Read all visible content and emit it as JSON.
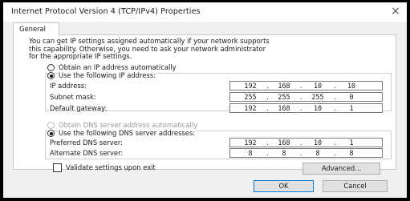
{
  "window": {
    "title": "Internet Protocol Version 4 (TCP/IPv4) Properties",
    "close_glyph": "×"
  },
  "tabs": [
    {
      "label": "General",
      "selected": true
    }
  ],
  "description": [
    "You can get IP settings assigned automatically if your network supports",
    "this capability. Otherwise, you need to ask your network administrator",
    "for the appropriate IP settings."
  ],
  "ip_mode": {
    "auto_label": "Obtain an IP address automatically",
    "manual_label": "Use the following IP address:",
    "selected": "manual"
  },
  "ip_fields": [
    {
      "label": "IP address:",
      "value": [
        "192",
        "168",
        "10",
        "10"
      ]
    },
    {
      "label": "Subnet mask:",
      "value": [
        "255",
        "255",
        "255",
        "0"
      ]
    },
    {
      "label": "Default gateway:",
      "value": [
        "192",
        "168",
        "10",
        "1"
      ]
    }
  ],
  "dns_mode": {
    "auto_label": "Obtain DNS server address automatically",
    "manual_label": "Use the following DNS server addresses:",
    "selected": "manual",
    "auto_disabled": true
  },
  "dns_fields": [
    {
      "label": "Preferred DNS server:",
      "value": [
        "192",
        "168",
        "10",
        "1"
      ]
    },
    {
      "label": "Alternate DNS server:",
      "value": [
        "8",
        "8",
        "8",
        "8"
      ]
    }
  ],
  "validate": {
    "label": "Validate settings upon exit",
    "checked": false
  },
  "buttons": {
    "advanced": "Advanced...",
    "ok": "OK",
    "cancel": "Cancel"
  },
  "colors": {
    "ok_border": "#0078d7",
    "window_bg": "#f0f0f0",
    "panel_bg": "#ffffff"
  }
}
